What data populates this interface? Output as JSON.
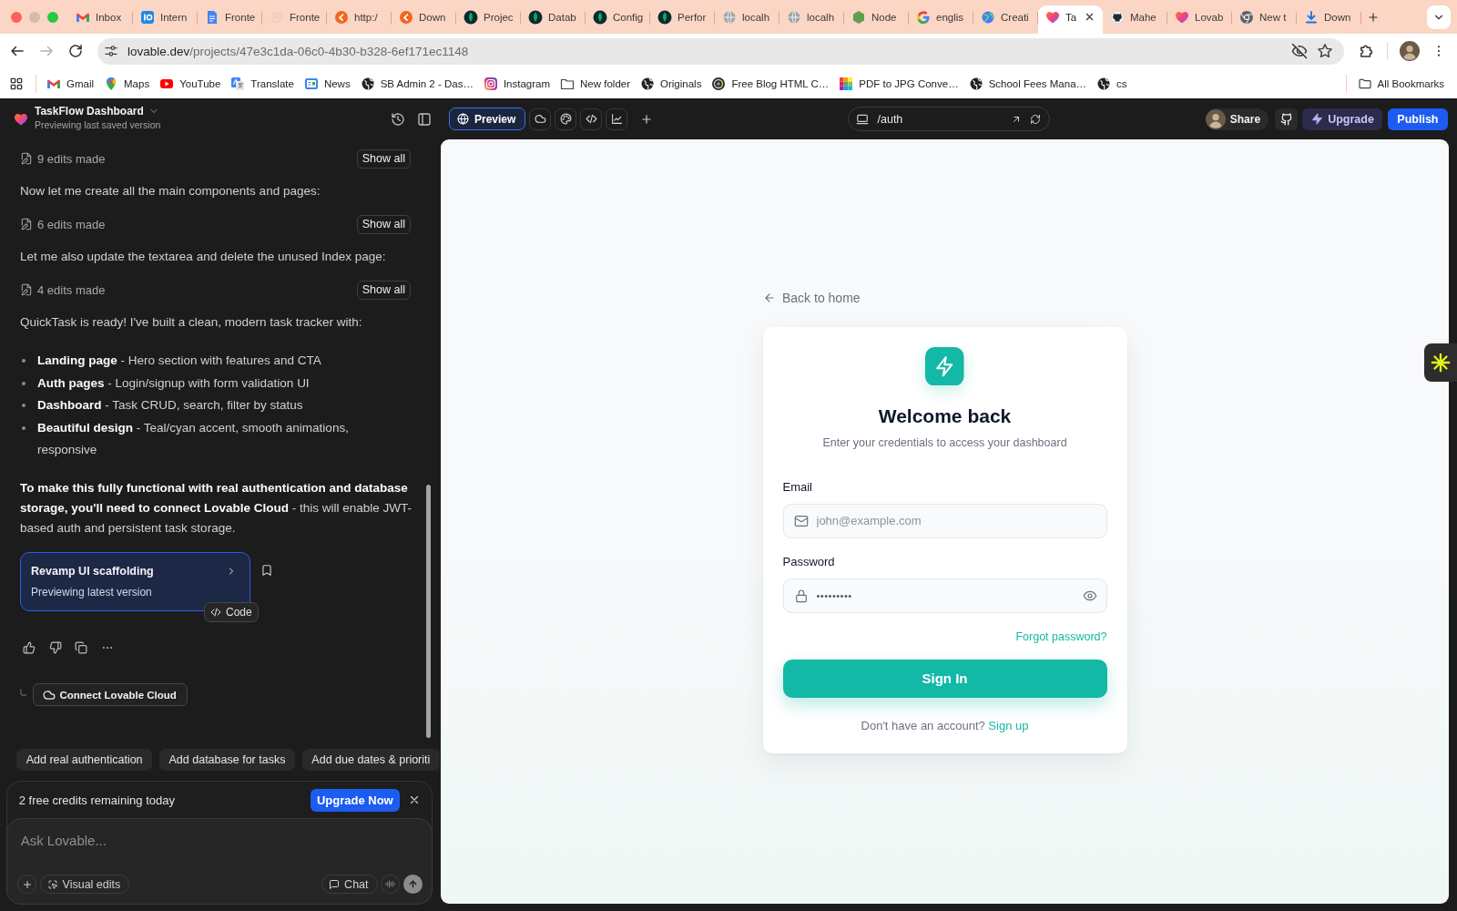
{
  "browser": {
    "tabs": [
      {
        "title": "Inbox",
        "kind": "mail",
        "selected": false
      },
      {
        "title": "Intern",
        "kind": "badge",
        "selected": false
      },
      {
        "title": "Fronte",
        "kind": "doc",
        "selected": false
      },
      {
        "title": "Fronte",
        "kind": "knot",
        "selected": false
      },
      {
        "title": "http:/",
        "kind": "flame",
        "selected": false
      },
      {
        "title": "Down",
        "kind": "flame",
        "selected": false
      },
      {
        "title": "Projec",
        "kind": "leaf",
        "selected": false
      },
      {
        "title": "Datab",
        "kind": "leaf",
        "selected": false
      },
      {
        "title": "Config",
        "kind": "leaf",
        "selected": false
      },
      {
        "title": "Perfor",
        "kind": "leaf",
        "selected": false
      },
      {
        "title": "localh",
        "kind": "globe",
        "selected": false
      },
      {
        "title": "localh",
        "kind": "globe",
        "selected": false
      },
      {
        "title": "Node",
        "kind": "hexagon",
        "selected": false
      },
      {
        "title": "englis",
        "kind": "google",
        "selected": false
      },
      {
        "title": "Creati",
        "kind": "earth",
        "selected": false
      },
      {
        "title": "Ta",
        "kind": "heart",
        "selected": true
      },
      {
        "title": "Mahe",
        "kind": "github",
        "selected": false
      },
      {
        "title": "Lovab",
        "kind": "heart",
        "selected": false
      },
      {
        "title": "New t",
        "kind": "chrome",
        "selected": false
      },
      {
        "title": "Down",
        "kind": "download",
        "selected": false
      }
    ],
    "address": {
      "host": "lovable.dev",
      "path": "/projects/47e3c1da-06c0-4b30-b328-6ef171ec1148"
    },
    "bookmarks": [
      {
        "title": "Gmail",
        "kind": "mail"
      },
      {
        "title": "Maps",
        "kind": "pin"
      },
      {
        "title": "YouTube",
        "kind": "play"
      },
      {
        "title": "Translate",
        "kind": "translate"
      },
      {
        "title": "News",
        "kind": "news"
      },
      {
        "title": "SB Admin 2 - Das…",
        "kind": "web"
      },
      {
        "title": "Instagram",
        "kind": "camera"
      },
      {
        "title": "New folder",
        "kind": "folder"
      },
      {
        "title": "Originals",
        "kind": "web"
      },
      {
        "title": "Free Blog HTML C…",
        "kind": "emblem"
      },
      {
        "title": "PDF to JPG Conve…",
        "kind": "tiles"
      },
      {
        "title": "School Fees Mana…",
        "kind": "web"
      },
      {
        "title": "cs",
        "kind": "web"
      }
    ],
    "all_bookmarks": "All Bookmarks"
  },
  "project": {
    "name": "TaskFlow Dashboard",
    "status": "Previewing last saved version"
  },
  "chat": {
    "messages": [
      {
        "kind": "edits",
        "text": "9 edits made",
        "button": "Show all"
      },
      {
        "kind": "text",
        "text": "Now let me create all the main components and pages:"
      },
      {
        "kind": "edits",
        "text": "6 edits made",
        "button": "Show all"
      },
      {
        "kind": "text",
        "text": "Let me also update the textarea and delete the unused Index page:"
      },
      {
        "kind": "edits",
        "text": "4 edits made",
        "button": "Show all"
      },
      {
        "kind": "text",
        "text": "QuickTask is ready! I've built a clean, modern task tracker with:"
      },
      {
        "kind": "bullets",
        "items": [
          "**Landing page** - Hero section with features and CTA",
          "**Auth pages** - Login/signup with form validation UI",
          "**Dashboard** - Task CRUD, search, filter by status",
          "**Beautiful design** - Teal/cyan accent, smooth animations, responsive"
        ]
      },
      {
        "kind": "text",
        "text": "**To make this fully functional with real authentication and database storage, you'll need to connect Lovable Cloud** - this will enable JWT-based auth and persistent task storage."
      }
    ],
    "version_card": {
      "title": "Revamp UI scaffolding",
      "subtitle": "Previewing latest version",
      "code_label": "Code"
    },
    "connect_button": "Connect Lovable Cloud",
    "suggestions": [
      "Add real authentication",
      "Add database for tasks",
      "Add due dates & prioriti"
    ],
    "credits": {
      "text": "2 free credits remaining today",
      "button": "Upgrade Now"
    },
    "composer": {
      "placeholder": "Ask Lovable...",
      "visual_edits": "Visual edits",
      "chat": "Chat"
    }
  },
  "toolbar": {
    "views": [
      {
        "kind": "preview",
        "label": "Preview",
        "selected": true
      },
      {
        "kind": "cloud",
        "selected": false
      },
      {
        "kind": "palette",
        "selected": false
      },
      {
        "kind": "code",
        "selected": false
      },
      {
        "kind": "chart",
        "selected": false
      }
    ],
    "route": "/auth",
    "share": "Share",
    "upgrade": "Upgrade",
    "publish": "Publish"
  },
  "preview": {
    "back_link": "Back to home",
    "title": "Welcome back",
    "subtitle": "Enter your credentials to access your dashboard",
    "fields": [
      {
        "kind": "email",
        "label": "Email",
        "placeholder": "john@example.com"
      },
      {
        "kind": "password",
        "label": "Password",
        "value": "•••••••••"
      }
    ],
    "forgot_link": "Forgot password?",
    "submit": "Sign In",
    "signup_prompt": "Don't have an account?",
    "signup_link": "Sign up"
  }
}
